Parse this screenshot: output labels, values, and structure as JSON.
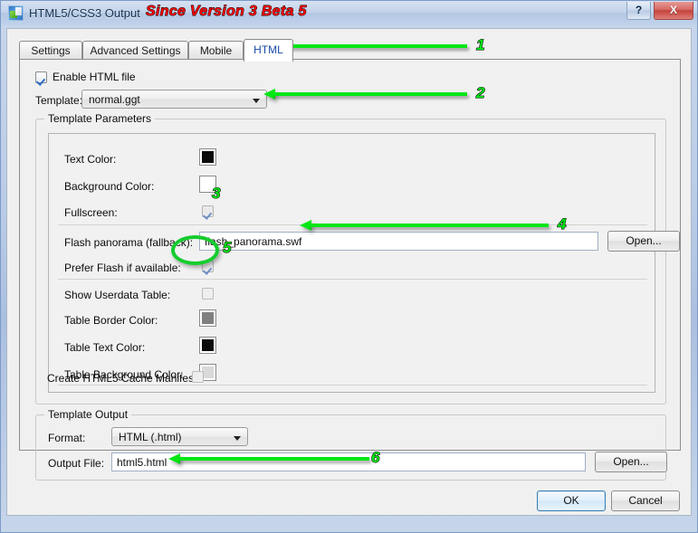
{
  "window": {
    "title": "HTML5/CSS3 Output",
    "annotation_note": "Since Version 3 Beta 5",
    "help_button": "?",
    "close_button": "X"
  },
  "tabs": [
    {
      "label": "Settings",
      "selected": false
    },
    {
      "label": "Advanced Settings",
      "selected": false
    },
    {
      "label": "Mobile",
      "selected": false
    },
    {
      "label": "HTML",
      "selected": true
    }
  ],
  "html_tab": {
    "enable_checkbox": {
      "label": "Enable HTML file",
      "checked": true
    },
    "template": {
      "label": "Template:",
      "value": "normal.ggt"
    },
    "parameters_group": {
      "title": "Template Parameters",
      "rows": [
        {
          "label": "Text Color:",
          "type": "swatch",
          "color": "#0a0a0a"
        },
        {
          "label": "Background Color:",
          "type": "swatch",
          "color": "#ffffff"
        },
        {
          "label": "Fullscreen:",
          "type": "checkbox",
          "checked": true
        },
        {
          "label": "Flash panorama (fallback):",
          "type": "text",
          "value": "flash_panorama.swf",
          "button": "Open..."
        },
        {
          "label": "Prefer Flash if available:",
          "type": "checkbox",
          "checked": true
        },
        {
          "label": "Show Userdata Table:",
          "type": "checkbox",
          "checked": false
        },
        {
          "label": "Table Border Color:",
          "type": "swatch",
          "color": "#808080"
        },
        {
          "label": "Table Text Color:",
          "type": "swatch",
          "color": "#0a0a0a"
        },
        {
          "label": "Table Background Color:",
          "type": "swatch",
          "color": "#d9d9d9"
        },
        {
          "label": "Create HTML5 Cache Manifest:",
          "type": "checkbox",
          "checked": false
        }
      ]
    },
    "output_group": {
      "title": "Template Output",
      "format_label": "Format:",
      "format_value": "HTML (.html)",
      "output_label": "Output File:",
      "output_value": "html5.html",
      "open_button": "Open..."
    }
  },
  "footer": {
    "ok": "OK",
    "cancel": "Cancel"
  },
  "annotations": {
    "markers": [
      "1",
      "2",
      "3",
      "4",
      "5",
      "6"
    ],
    "arrow_color": "#00e715",
    "note_color": "#fe0000"
  }
}
